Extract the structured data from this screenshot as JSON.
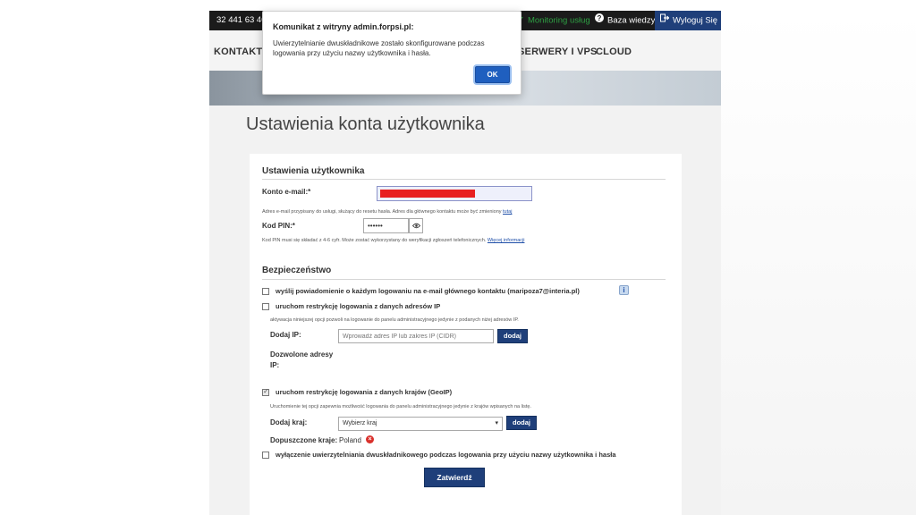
{
  "topbar": {
    "phone": "32 441 63 46",
    "monitoring_label": "Monitoring usług",
    "knowledge_label": "Baza wiedzy",
    "logout_label": "Wyloguj Się"
  },
  "nav": {
    "items": [
      {
        "label": "KONTAKTY"
      },
      {
        "label": "SERWERY I VPS"
      },
      {
        "label": "CLOUD"
      }
    ]
  },
  "dialog": {
    "title": "Komunikat z witryny admin.forpsi.pl:",
    "message": "Uwierzytelnianie dwuskładnikowe zostało skonfigurowane podczas logowania przy użyciu nazwy użytkownika i hasła.",
    "ok_label": "OK"
  },
  "page": {
    "title": "Ustawienia konta użytkownika"
  },
  "user_settings": {
    "section_title": "Ustawienia użytkownika",
    "email_label": "Konto e-mail:*",
    "email_help": "Adres e-mail przypisany do usługi, służący do resetu hasła. Adres dla głównego kontaktu może być zmieniony",
    "email_help_link": "tutaj",
    "pin_label": "Kod PIN:*",
    "pin_value": "••••••",
    "pin_help": "Kod PIN musi się składać z 4-6 cyfr. Może zostać wykorzystany do weryfikacji zgłoszeń telefonicznych.",
    "pin_help_link": "Więcej informacji"
  },
  "security": {
    "section_title": "Bezpieczeństwo",
    "notify_label": "wyślij powiadomienie o każdym logowaniu na e-mail głównego kontaktu (maripoza7@interia.pl)",
    "ip_restrict_label": "uruchom restrykcję logowania z danych adresów IP",
    "ip_help": "aktywacja niniejszej opcji pozwoli na logowanie do panelu administracyjnego jedynie z podanych niżej adresów IP.",
    "add_ip_label": "Dodaj IP:",
    "ip_placeholder": "Wprowadź adres IP lub zakres IP (CIDR)",
    "add_button": "dodaj",
    "allowed_ip_label_1": "Dozwolone adresy",
    "allowed_ip_label_2": "IP:",
    "geoip_label": "uruchom restrykcję logowania z danych krajów (GeoIP)",
    "geoip_help": "Uruchomienie tej opcji zapewnia możliwość logowania do panelu administracyjnego jedynie z krajów wpisanych na listę.",
    "add_country_label": "Dodaj kraj:",
    "country_select": "Wybierz kraj",
    "add_country_button": "dodaj",
    "allowed_countries_label": "Dopuszczone kraje:",
    "allowed_country_value": "Poland",
    "disable_2fa_label": "wyłączenie uwierzytelniania dwuskładnikowego podczas logowania przy użyciu nazwy użytkownika i hasła",
    "submit_label": "Zatwierdź"
  },
  "state": {
    "notify_checked": false,
    "ip_restrict_checked": false,
    "geoip_checked": true,
    "disable_2fa_checked": false
  },
  "colors": {
    "topbar_bg": "#1b1b1b",
    "monitoring_accent": "#2ea043",
    "logout_bg": "#1f3f7a",
    "button_navy": "#1f3f7a",
    "dialog_ok": "#1f5fbf",
    "redaction": "#e8201f"
  }
}
